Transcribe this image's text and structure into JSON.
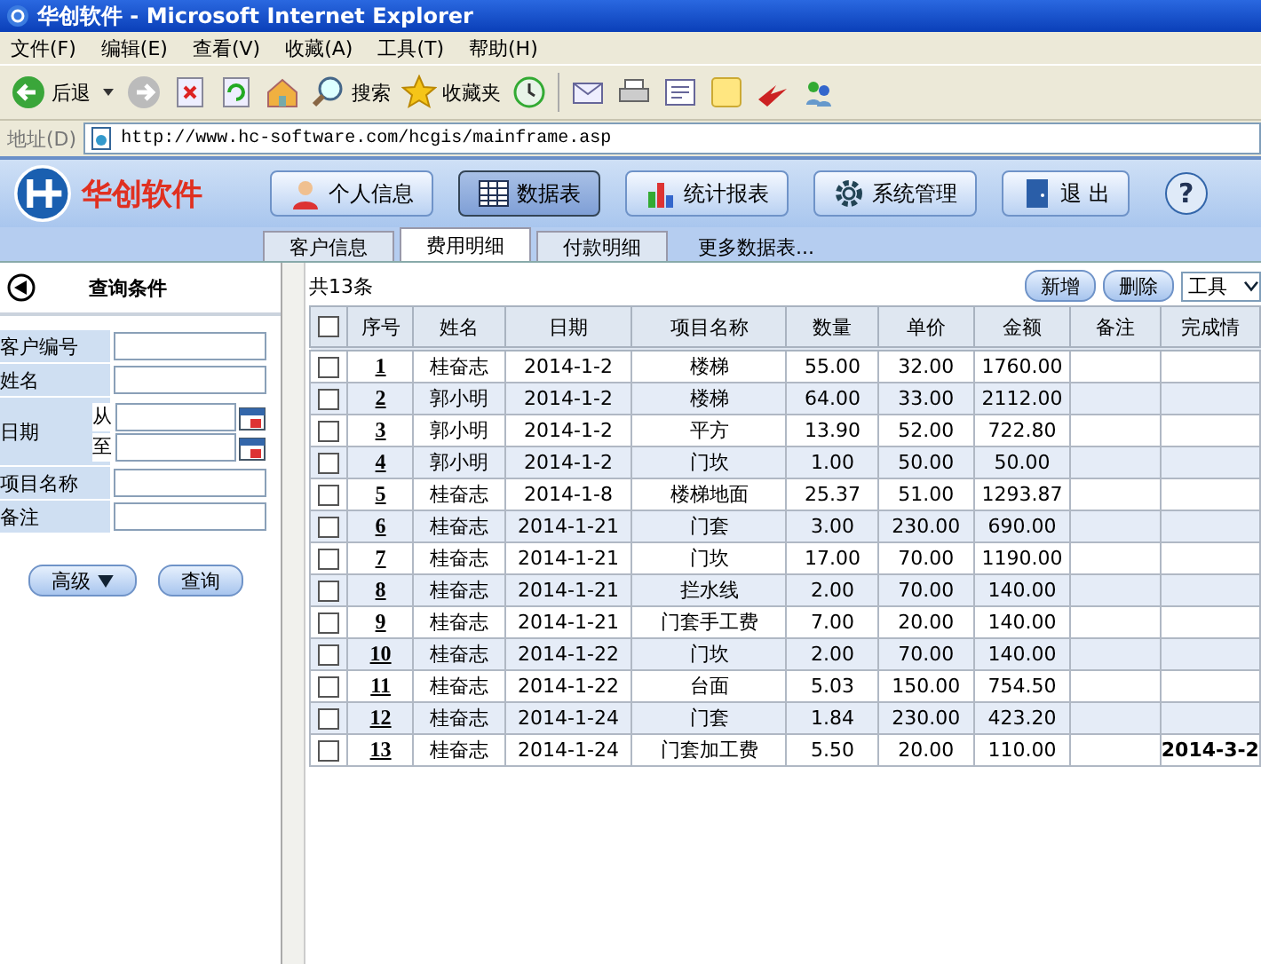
{
  "window": {
    "title": "华创软件 - Microsoft Internet Explorer"
  },
  "menu": [
    "文件(F)",
    "编辑(E)",
    "查看(V)",
    "收藏(A)",
    "工具(T)",
    "帮助(H)"
  ],
  "toolbar": {
    "back": "后退",
    "search": "搜索",
    "favorites": "收藏夹"
  },
  "address": {
    "label": "地址(D)",
    "value": "http://www.hc-software.com/hcgis/mainframe.asp"
  },
  "app": {
    "logo": "华创软件",
    "help": "?",
    "nav": [
      {
        "label": "个人信息",
        "selected": false
      },
      {
        "label": "数据表",
        "selected": true
      },
      {
        "label": "统计报表",
        "selected": false
      },
      {
        "label": "系统管理",
        "selected": false
      },
      {
        "label": "退 出",
        "selected": false
      }
    ],
    "tabs": [
      {
        "label": "客户信息",
        "selected": false
      },
      {
        "label": "费用明细",
        "selected": true
      },
      {
        "label": "付款明细",
        "selected": false
      },
      {
        "label": "更多数据表...",
        "selected": false
      }
    ]
  },
  "query": {
    "title": "查询条件",
    "fields": [
      {
        "kind": "text",
        "label": "客户编号"
      },
      {
        "kind": "text",
        "label": "姓名"
      },
      {
        "kind": "date-range",
        "label": "日期",
        "from": "从",
        "to": "至"
      },
      {
        "kind": "text",
        "label": "项目名称"
      },
      {
        "kind": "text",
        "label": "备注"
      }
    ],
    "advanced": "高级",
    "submit": "查询"
  },
  "table": {
    "count": "共13条",
    "add": "新增",
    "delete": "删除",
    "tools": "工具",
    "all_checked": false,
    "columns": [
      "序号",
      "姓名",
      "日期",
      "项目名称",
      "数量",
      "单价",
      "金额",
      "备注",
      "完成情"
    ],
    "rows": [
      {
        "checked": false,
        "cells": [
          "1",
          "桂奋志",
          "2014-1-2",
          "楼梯",
          "55.00",
          "32.00",
          "1760.00",
          "",
          ""
        ]
      },
      {
        "checked": false,
        "cells": [
          "2",
          "郭小明",
          "2014-1-2",
          "楼梯",
          "64.00",
          "33.00",
          "2112.00",
          "",
          ""
        ]
      },
      {
        "checked": false,
        "cells": [
          "3",
          "郭小明",
          "2014-1-2",
          "平方",
          "13.90",
          "52.00",
          "722.80",
          "",
          ""
        ]
      },
      {
        "checked": false,
        "cells": [
          "4",
          "郭小明",
          "2014-1-2",
          "门坎",
          "1.00",
          "50.00",
          "50.00",
          "",
          ""
        ]
      },
      {
        "checked": false,
        "cells": [
          "5",
          "桂奋志",
          "2014-1-8",
          "楼梯地面",
          "25.37",
          "51.00",
          "1293.87",
          "",
          ""
        ]
      },
      {
        "checked": false,
        "cells": [
          "6",
          "桂奋志",
          "2014-1-21",
          "门套",
          "3.00",
          "230.00",
          "690.00",
          "",
          ""
        ]
      },
      {
        "checked": false,
        "cells": [
          "7",
          "桂奋志",
          "2014-1-21",
          "门坎",
          "17.00",
          "70.00",
          "1190.00",
          "",
          ""
        ]
      },
      {
        "checked": false,
        "cells": [
          "8",
          "桂奋志",
          "2014-1-21",
          "拦水线",
          "2.00",
          "70.00",
          "140.00",
          "",
          ""
        ]
      },
      {
        "checked": false,
        "cells": [
          "9",
          "桂奋志",
          "2014-1-21",
          "门套手工费",
          "7.00",
          "20.00",
          "140.00",
          "",
          ""
        ]
      },
      {
        "checked": false,
        "cells": [
          "10",
          "桂奋志",
          "2014-1-22",
          "门坎",
          "2.00",
          "70.00",
          "140.00",
          "",
          ""
        ]
      },
      {
        "checked": false,
        "cells": [
          "11",
          "桂奋志",
          "2014-1-22",
          "台面",
          "5.03",
          "150.00",
          "754.50",
          "",
          ""
        ]
      },
      {
        "checked": false,
        "cells": [
          "12",
          "桂奋志",
          "2014-1-24",
          "门套",
          "1.84",
          "230.00",
          "423.20",
          "",
          ""
        ]
      },
      {
        "checked": false,
        "cells": [
          "13",
          "桂奋志",
          "2014-1-24",
          "门套加工费",
          "5.50",
          "20.00",
          "110.00",
          "",
          "2014-3-2"
        ]
      }
    ]
  }
}
